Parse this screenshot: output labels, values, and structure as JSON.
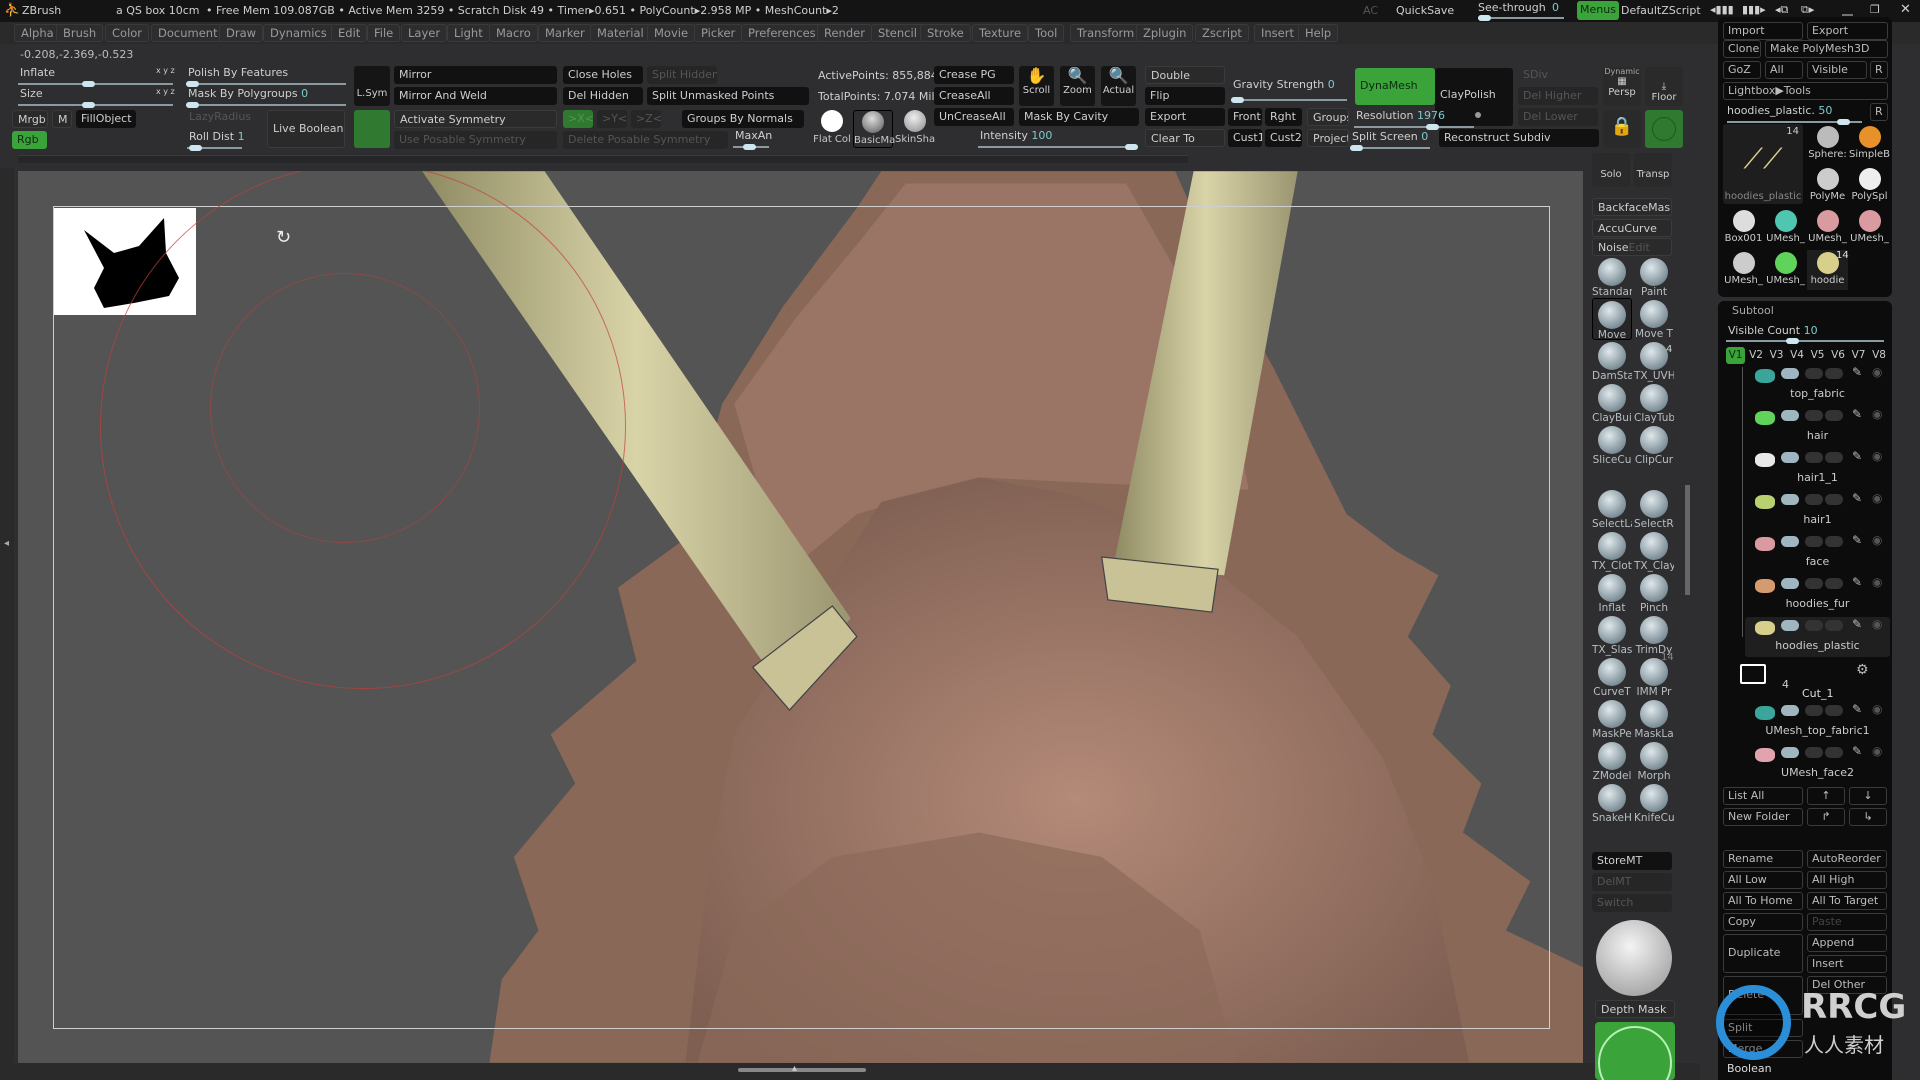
{
  "titlebar": {
    "app": "ZBrush",
    "doc": "a QS box 10cm",
    "status": "• Free Mem 109.087GB • Active Mem 3259 • Scratch Disk 49 • Timer▸0.651 • PolyCount▸2.958 MP • MeshCount▸2",
    "ac": "AC",
    "quicksave": "QuickSave",
    "seethrough_label": "See-through",
    "seethrough_value": "0",
    "seethrough_fraction": 0,
    "menus": "Menus",
    "script": "DefaultZScript"
  },
  "menus": [
    "Alpha",
    "Brush",
    "Color",
    "Document",
    "Draw",
    "Dynamics",
    "Edit",
    "File",
    "Layer",
    "Light",
    "Macro",
    "Marker",
    "Material",
    "Movie",
    "Picker",
    "Preferences",
    "Render",
    "Stencil",
    "Stroke",
    "Texture",
    "Tool",
    "Transform",
    "Zplugin",
    "Zscript",
    "Insert",
    "Help"
  ],
  "coords": "-0.208,-2.369,-0.523",
  "shelf": {
    "inflate": "Inflate",
    "size": "Size",
    "xyz": "x y z",
    "polish": "Polish By Features",
    "mask_pg": "Mask By Polygroups",
    "mask_pg_value": "0",
    "mrgb": "Mrgb",
    "m": "M",
    "fill": "FillObject",
    "rgb": "Rgb",
    "lazy": "LazyRadius",
    "roll": "Roll Dist",
    "roll_value": "1",
    "live_boolean": "Live Boolean",
    "lsym": "L.Sym",
    "mirror": "Mirror",
    "mirror_weld": "Mirror And Weld",
    "activate_sym": "Activate Symmetry",
    "posable": "Use Posable Symmetry",
    "close_holes": "Close Holes",
    "split_hidden": "Split Hidden",
    "del_hidden": "Del Hidden",
    "split_unmasked": "Split Unmasked Points",
    "x": ">X<",
    "y": ">Y<",
    "z": ">Z<",
    "groups_normals": "Groups By Normals",
    "del_posable": "Delete Posable Symmetry",
    "maxan": "MaxAn",
    "active_points": "ActivePoints: 855,884",
    "total_points": "TotalPoints: 7.074 Mil",
    "materials": [
      "Flat Col",
      "BasicMa",
      "SkinSha"
    ],
    "crease_pg": "Crease PG",
    "crease_all": "CreaseAll",
    "uncrease_all": "UnCreaseAll",
    "scroll": "Scroll",
    "zoom": "Zoom",
    "actual": "Actual",
    "mask_cavity": "Mask By Cavity",
    "intensity": "Intensity",
    "intensity_value": "100",
    "double": "Double",
    "flip": "Flip",
    "export": "Export",
    "clear_to": "Clear To",
    "gravity": "Gravity Strength",
    "gravity_value": "0",
    "front": "Front",
    "rght": "Rght",
    "cust1": "Cust1",
    "cust2": "Cust2",
    "groups": "Groups",
    "project": "Project",
    "dynamesh": "DynaMesh",
    "claypolish": "ClayPolish",
    "resolution": "Resolution",
    "resolution_value": "1976",
    "split_screen": "Split Screen",
    "split_screen_value": "0",
    "sdiv": "SDiv",
    "del_higher": "Del Higher",
    "del_lower": "Del Lower",
    "reconstruct": "Reconstruct Subdiv",
    "dynamic": "Dynamic",
    "persp": "Persp",
    "floor": "Floor"
  },
  "brushes": {
    "solo": "Solo",
    "transp": "Transp",
    "backface": "BackfaceMask",
    "accucurve": "AccuCurve",
    "noise": "Noise",
    "noise_edit": "Edit",
    "items": [
      "Standar",
      "Paint",
      "Move",
      "Move T",
      "DamSta",
      "TX_UVH",
      "ClayBui",
      "ClayTub",
      "SliceCu",
      "ClipCur",
      "SelectLa",
      "SelectRe",
      "TX_Clot",
      "TX_Clay",
      "Inflat",
      "Pinch",
      "TX_Slasl",
      "TrimDy",
      "CurveT",
      "IMM Pr",
      "MaskPe",
      "MaskLa",
      "ZModel",
      "Morph",
      "SnakeH",
      "KnifeCu"
    ],
    "txuvh_count": "4",
    "imm_count": "14",
    "storemt": "StoreMT",
    "delmt": "DelMT",
    "switch": "Switch",
    "depth_mask": "Depth Mask"
  },
  "tool": {
    "import": "Import",
    "export": "Export",
    "clone": "Clone",
    "make_polymesh": "Make PolyMesh3D",
    "goz": "GoZ",
    "all": "All",
    "visible": "Visible",
    "r": "R",
    "lightbox": "Lightbox▶Tools",
    "current": "hoodies_plastic.",
    "current_value": "50",
    "current_count": "14",
    "thumbs": [
      "hoodies_plastic",
      "Sphere:",
      "SimpleB",
      "PolyMe",
      "PolySpl",
      "Box001",
      "UMesh_",
      "UMesh_",
      "UMesh_",
      "UMesh_",
      "UMesh_",
      "hoodie"
    ],
    "thumb_count": "14"
  },
  "subtool": {
    "title": "Subtool",
    "visible_count": "Visible Count",
    "visible_count_value": "10",
    "versions": [
      "V1",
      "V2",
      "V3",
      "V4",
      "V5",
      "V6",
      "V7",
      "V8"
    ],
    "items": [
      {
        "name": "top_fabric",
        "color": "#3aa59a"
      },
      {
        "name": "hair",
        "color": "#5fd35a"
      },
      {
        "name": "hair1_1",
        "color": "#e8e8e8"
      },
      {
        "name": "hair1",
        "color": "#b9d070"
      },
      {
        "name": "face",
        "color": "#d99aa0"
      },
      {
        "name": "hoodies_fur",
        "color": "#d59a70"
      },
      {
        "name": "hoodies_plastic",
        "color": "#d8cf8c"
      }
    ],
    "folder": {
      "name": "Cut_1",
      "count": "4"
    },
    "folder_items": [
      {
        "name": "UMesh_top_fabric1",
        "color": "#3aa59a"
      },
      {
        "name": "UMesh_face2",
        "color": "#e1a3ad"
      }
    ],
    "list_all": "List All",
    "new_folder": "New Folder",
    "rename": "Rename",
    "autoreorder": "AutoReorder",
    "all_low": "All Low",
    "all_high": "All High",
    "all_home": "All To Home",
    "all_target": "All To Target",
    "copy": "Copy",
    "paste": "Paste",
    "duplicate": "Duplicate",
    "append": "Append",
    "insert": "Insert",
    "delete": "Delete",
    "del_other": "Del Other",
    "split": "Split",
    "merge": "Merge",
    "boolean": "Boolean"
  },
  "watermark": {
    "text": "RRCG",
    "sub": "人人素材"
  },
  "colors": {
    "accent_green": "#3aa33a",
    "value_teal": "#7fcaca",
    "brush_ring": "#c0403a",
    "model": "#a07c6a",
    "horn": "#cfc99a"
  }
}
